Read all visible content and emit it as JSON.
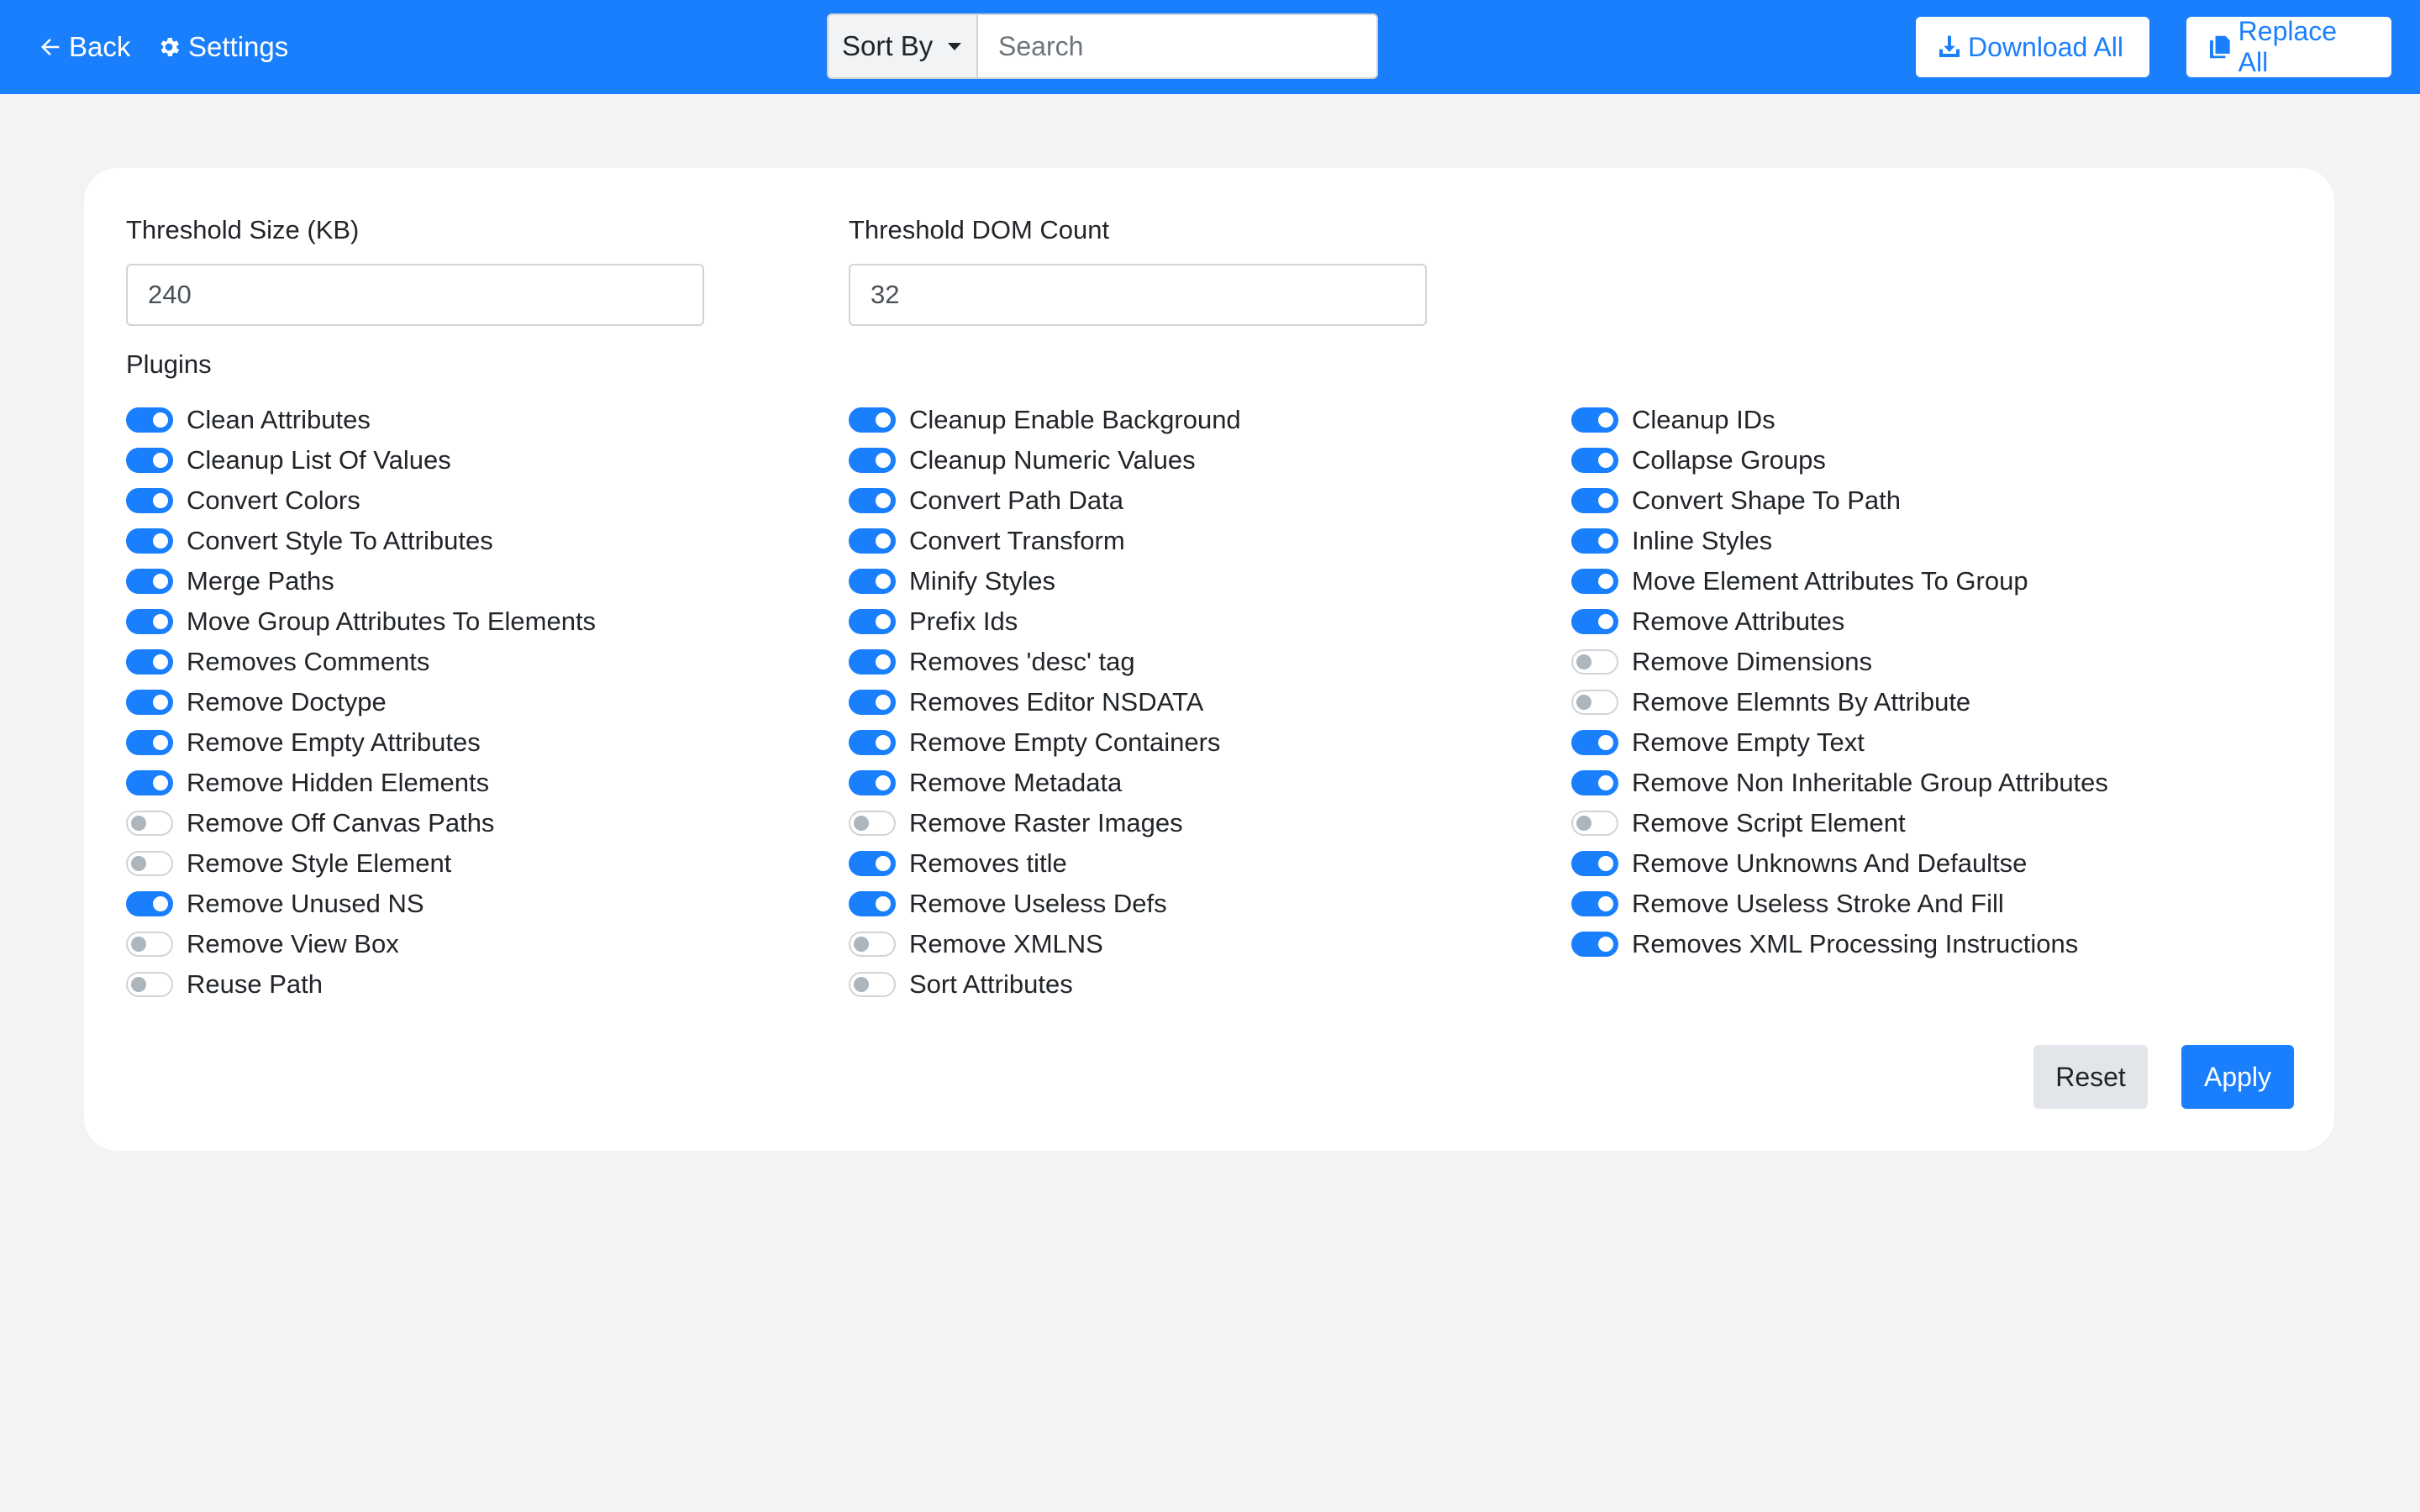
{
  "header": {
    "back_label": "Back",
    "settings_label": "Settings",
    "sort_label": "Sort By",
    "search_placeholder": "Search",
    "download_label": "Download All",
    "replace_label": "Replace All"
  },
  "form": {
    "threshold_size_label": "Threshold Size (KB)",
    "threshold_size_value": "240",
    "threshold_dom_label": "Threshold DOM Count",
    "threshold_dom_value": "32",
    "plugins_label": "Plugins"
  },
  "plugins": [
    [
      {
        "label": "Clean Attributes",
        "on": true
      },
      {
        "label": "Cleanup List Of Values",
        "on": true
      },
      {
        "label": "Convert Colors",
        "on": true
      },
      {
        "label": "Convert Style To Attributes",
        "on": true
      },
      {
        "label": "Merge Paths",
        "on": true
      },
      {
        "label": "Move Group Attributes To Elements",
        "on": true
      },
      {
        "label": "Removes Comments",
        "on": true
      },
      {
        "label": "Remove Doctype",
        "on": true
      },
      {
        "label": "Remove Empty Attributes",
        "on": true
      },
      {
        "label": "Remove Hidden Elements",
        "on": true
      },
      {
        "label": "Remove Off Canvas Paths",
        "on": false
      },
      {
        "label": "Remove Style Element",
        "on": false
      },
      {
        "label": "Remove Unused NS",
        "on": true
      },
      {
        "label": "Remove View Box",
        "on": false
      },
      {
        "label": "Reuse Path",
        "on": false
      }
    ],
    [
      {
        "label": "Cleanup Enable Background",
        "on": true
      },
      {
        "label": "Cleanup Numeric Values",
        "on": true
      },
      {
        "label": "Convert Path Data",
        "on": true
      },
      {
        "label": "Convert Transform",
        "on": true
      },
      {
        "label": "Minify Styles",
        "on": true
      },
      {
        "label": "Prefix Ids",
        "on": true
      },
      {
        "label": "Removes 'desc' tag",
        "on": true
      },
      {
        "label": "Removes Editor NSDATA",
        "on": true
      },
      {
        "label": "Remove Empty Containers",
        "on": true
      },
      {
        "label": "Remove Metadata",
        "on": true
      },
      {
        "label": "Remove Raster Images",
        "on": false
      },
      {
        "label": "Removes title",
        "on": true
      },
      {
        "label": "Remove Useless Defs",
        "on": true
      },
      {
        "label": "Remove XMLNS",
        "on": false
      },
      {
        "label": "Sort Attributes",
        "on": false
      }
    ],
    [
      {
        "label": "Cleanup IDs",
        "on": true
      },
      {
        "label": "Collapse Groups",
        "on": true
      },
      {
        "label": "Convert Shape To Path",
        "on": true
      },
      {
        "label": "Inline Styles",
        "on": true
      },
      {
        "label": "Move Element Attributes To Group",
        "on": true
      },
      {
        "label": "Remove Attributes",
        "on": true
      },
      {
        "label": "Remove Dimensions",
        "on": false
      },
      {
        "label": "Remove Elemnts By Attribute",
        "on": false
      },
      {
        "label": "Remove Empty Text",
        "on": true
      },
      {
        "label": "Remove Non Inheritable Group Attributes",
        "on": true
      },
      {
        "label": "Remove Script Element",
        "on": false
      },
      {
        "label": "Remove Unknowns And Defaultse",
        "on": true
      },
      {
        "label": "Remove Useless Stroke And Fill",
        "on": true
      },
      {
        "label": "Removes XML Processing Instructions",
        "on": true
      }
    ]
  ],
  "actions": {
    "reset_label": "Reset",
    "apply_label": "Apply"
  },
  "colors": {
    "primary": "#1a7ffc",
    "background": "#f3f3f3",
    "toggle_off": "#adb5bd"
  }
}
